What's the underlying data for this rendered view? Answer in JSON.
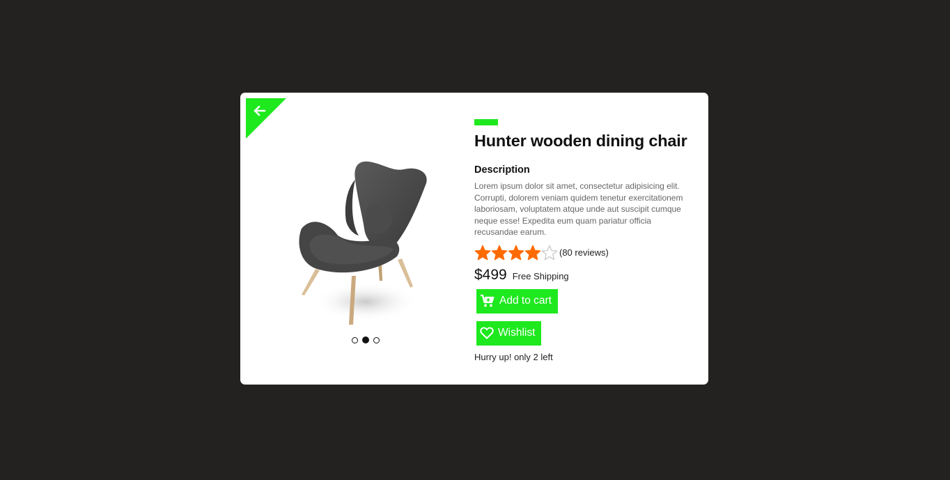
{
  "card": {
    "back_icon": "arrow-left-icon",
    "accent_color": "#1ee81e"
  },
  "product": {
    "title": "Hunter wooden dining chair",
    "description_heading": "Description",
    "description": "Lorem ipsum dolor sit amet, consectetur adipisicing elit. Corrupti, dolorem veniam quidem tenetur exercitationem laboriosam, voluptatem atque unde aut suscipit cumque neque esse! Expedita eum quam pariatur officia recusandae earum.",
    "rating": 4,
    "rating_max": 5,
    "reviews": "(80 reviews)",
    "price": "$499",
    "shipping": "Free Shipping",
    "add_to_cart": "Add to cart",
    "wishlist": "Wishlist",
    "stock_note": "Hurry up! only 2 left"
  },
  "carousel": {
    "total": 3,
    "active_index": 1
  },
  "colors": {
    "star": "#ff6a00",
    "star_empty": "#cccccc",
    "button": "#1ee81e"
  }
}
